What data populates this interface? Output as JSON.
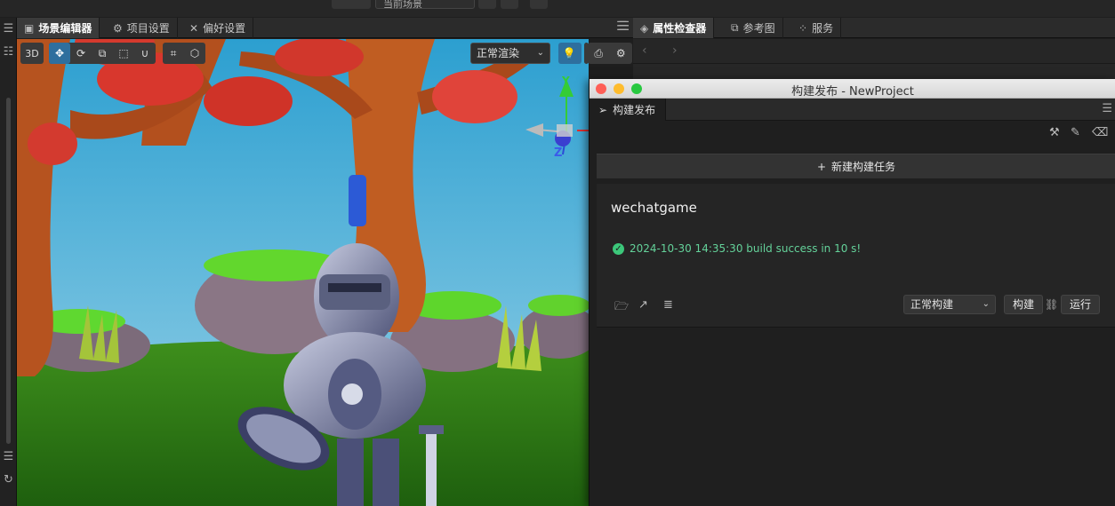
{
  "top_toolbar": {
    "scene_select_value": "当前场景"
  },
  "scene_panel": {
    "tabs": [
      {
        "label": "场景编辑器",
        "icon": "scene-icon"
      },
      {
        "label": "项目设置",
        "icon": "gear-icon"
      },
      {
        "label": "偏好设置",
        "icon": "wrench-icon"
      }
    ],
    "toolbar": {
      "mode_3d_label": "3D",
      "render_mode_value": "正常渲染",
      "gizmo_axes": {
        "y": "Y",
        "z": "Z"
      }
    }
  },
  "inspector_panel": {
    "tabs": [
      {
        "label": "属性检查器",
        "icon": "inspector-icon"
      },
      {
        "label": "参考图",
        "icon": "reference-image-icon"
      },
      {
        "label": "服务",
        "icon": "services-icon"
      }
    ]
  },
  "build_dialog": {
    "title": "构建发布 - NewProject",
    "tab_label": "构建发布",
    "new_task_label": "新建构建任务",
    "task": {
      "platform": "wechatgame",
      "status_text": "2024-10-30 14:35:30 build success in 10 s!",
      "build_mode_value": "正常构建",
      "build_button_label": "构建",
      "run_button_label": "运行"
    }
  },
  "colors": {
    "accent_blue": "#2e6f9e",
    "success_green": "#3cc77a",
    "traffic_red": "#fe5f57",
    "traffic_yellow": "#febc2e",
    "traffic_green": "#28c840"
  }
}
